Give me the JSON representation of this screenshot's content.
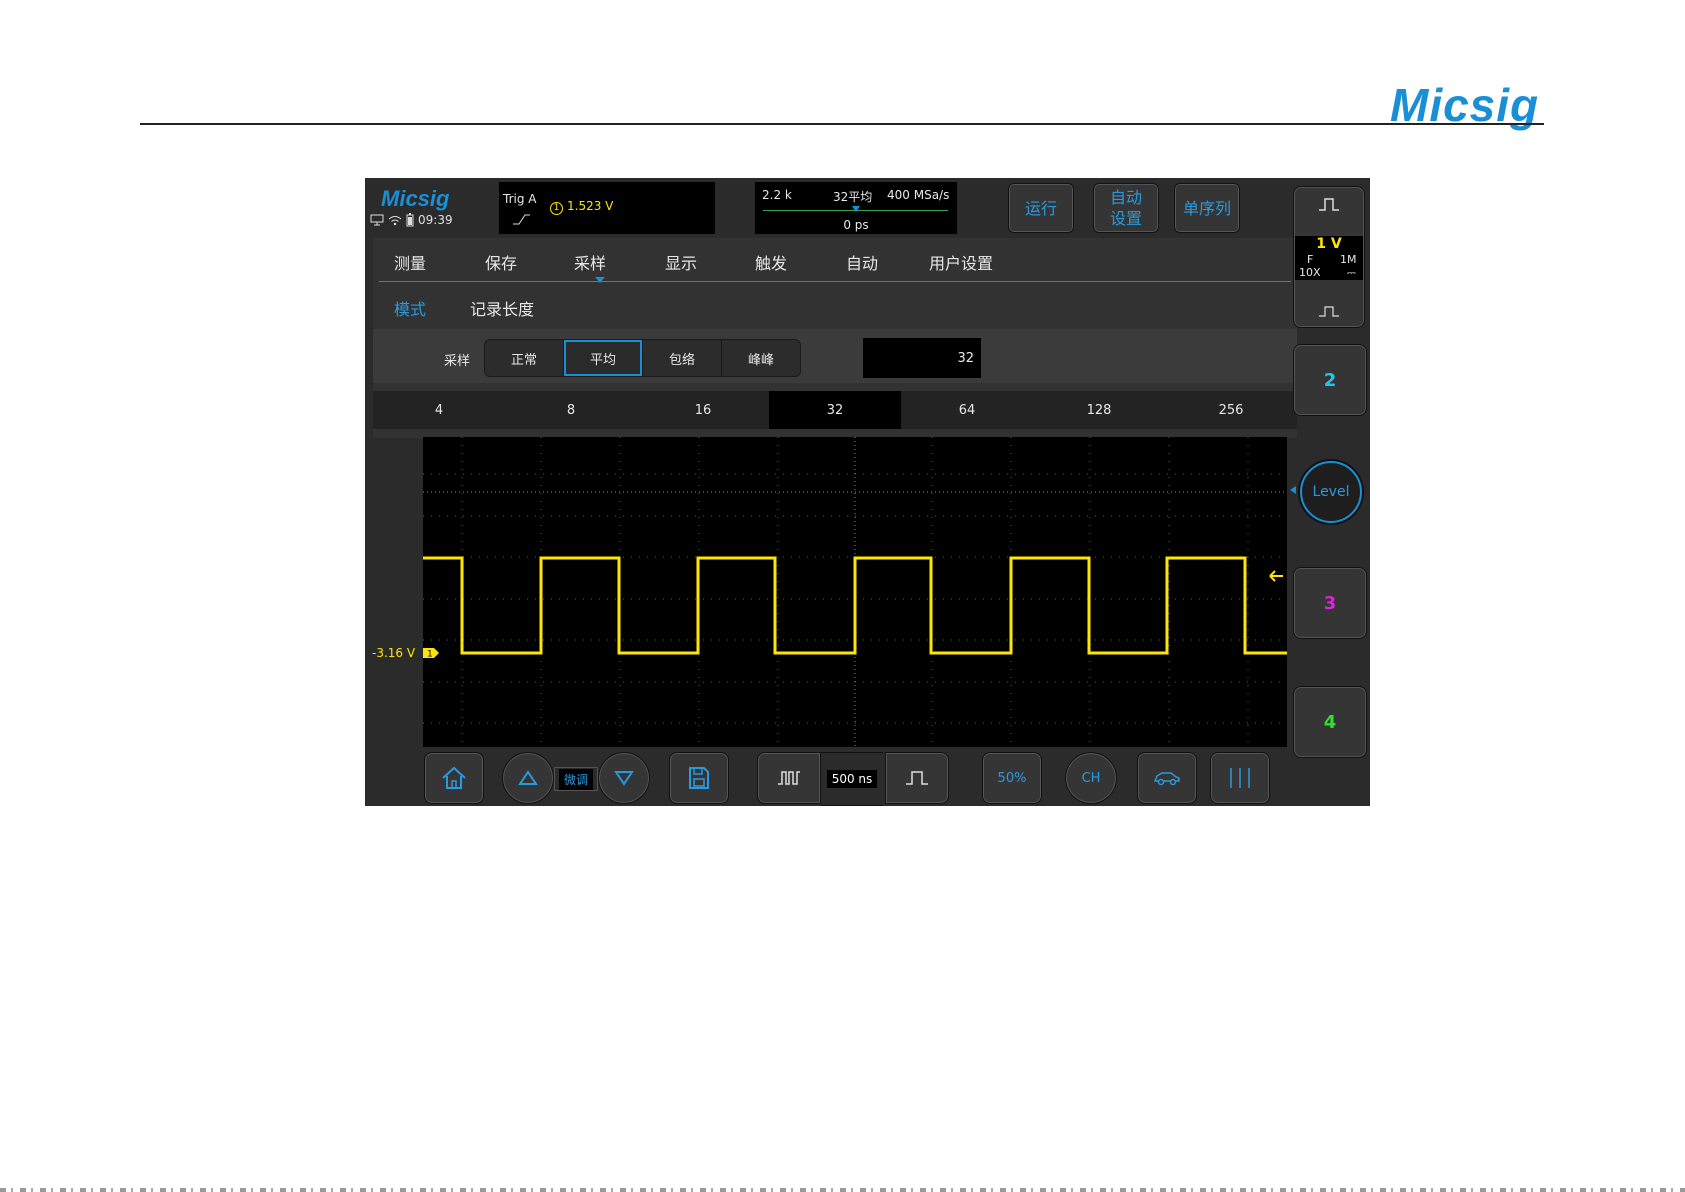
{
  "page": {
    "logo": "Micsig"
  },
  "scope": {
    "logo": "Micsig",
    "time": "09:39",
    "trigger": {
      "label": "Trig A",
      "channel": "1",
      "value": "1.523 V"
    },
    "acquisition": {
      "depth": "2.2 k",
      "mode": "32平均",
      "rate": "400 MSa/s",
      "position": "0 ps"
    },
    "buttons": {
      "run": "运行",
      "auto_line1": "自动",
      "auto_line2": "设置",
      "single": "单序列"
    },
    "tabs": [
      "测量",
      "保存",
      "采样",
      "显示",
      "触发",
      "自动",
      "用户设置"
    ],
    "subtabs": [
      "模式",
      "记录长度"
    ],
    "sampling": {
      "label": "采样",
      "options": [
        "正常",
        "平均",
        "包络",
        "峰峰"
      ],
      "selected": "平均",
      "count_value": "32"
    },
    "average_counts": [
      "4",
      "8",
      "16",
      "32",
      "64",
      "128",
      "256"
    ],
    "selected_count": "32",
    "channel1": {
      "offset_label": "-3.16 V",
      "marker": "1",
      "scale": "1 V",
      "coupling": "F",
      "impedance": "1M",
      "probe": "10X",
      "probe_symbol": "⎓"
    },
    "channels": [
      "2",
      "3",
      "4"
    ],
    "level_label": "Level",
    "bottom": {
      "fine": "微调",
      "timebase": "500 ns",
      "fifty": "50%",
      "ch": "CH"
    },
    "colors": {
      "ch1": "#ffe600",
      "ch2": "#1ec8f0",
      "ch3": "#e020e0",
      "ch4": "#30e030",
      "accent": "#1a8fd6"
    }
  }
}
